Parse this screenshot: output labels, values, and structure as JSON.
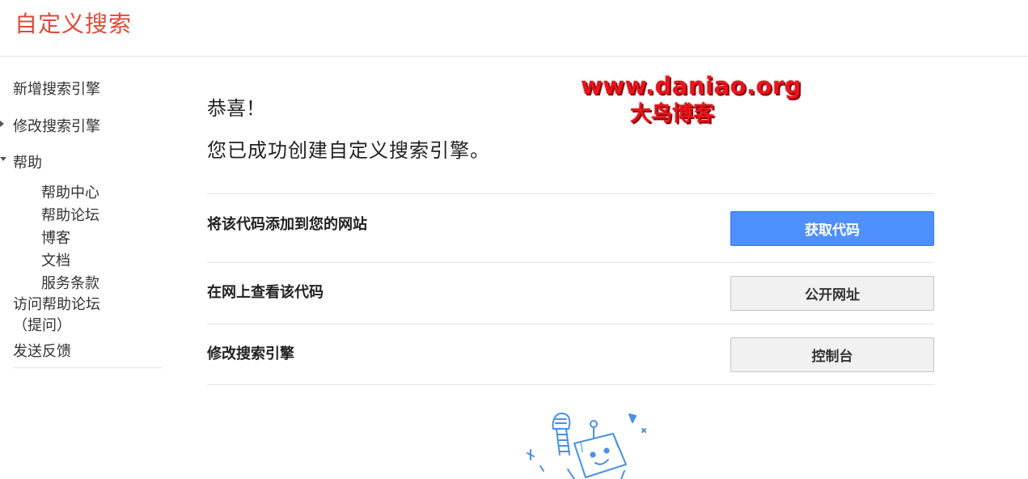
{
  "header": {
    "title": "自定义搜索"
  },
  "sidebar": {
    "items": [
      {
        "label": "新增搜索引擎"
      },
      {
        "label": "修改搜索引擎"
      },
      {
        "label": "帮助"
      }
    ],
    "help_subitems": [
      {
        "label": "帮助中心"
      },
      {
        "label": "帮助论坛"
      },
      {
        "label": "博客"
      },
      {
        "label": "文档"
      },
      {
        "label": "服务条款"
      }
    ],
    "forum_link": {
      "line1": "访问帮助论坛",
      "line2": "（提问）"
    },
    "feedback": {
      "label": "发送反馈"
    }
  },
  "main": {
    "congrats": "恭喜！",
    "success_message": "您已成功创建自定义搜索引擎。",
    "rows": [
      {
        "label": "将该代码添加到您的网站",
        "button": "获取代码"
      },
      {
        "label": "在网上查看该代码",
        "button": "公开网址"
      },
      {
        "label": "修改搜索引擎",
        "button": "控制台"
      }
    ]
  },
  "watermark": {
    "url": "www.daniao.org",
    "name": "大鸟博客"
  },
  "colors": {
    "title": "#dd4b39",
    "primary_button": "#4d90fe",
    "watermark": "#e8141e",
    "robot_line": "#4a90e2"
  },
  "illustration": {
    "icon": "robot-mascot-icon"
  }
}
